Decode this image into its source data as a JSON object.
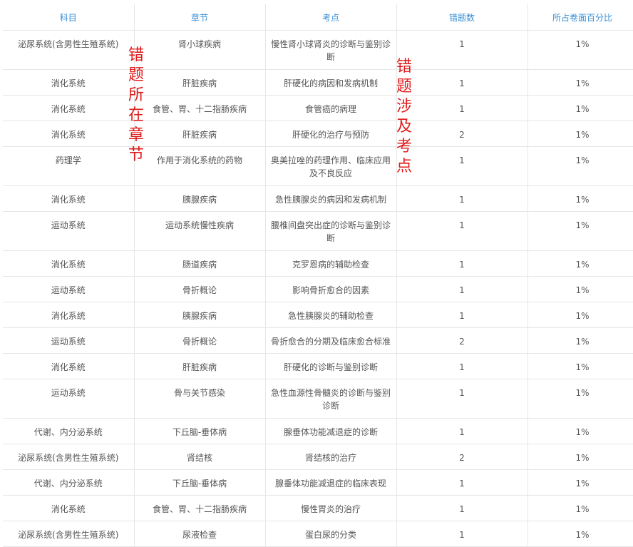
{
  "table": {
    "headers": [
      "科目",
      "章节",
      "考点",
      "错题数",
      "所占卷面百分比"
    ],
    "rows": [
      {
        "subject": "泌尿系统(含男性生殖系统)",
        "chapter": "肾小球疾病",
        "point": "慢性肾小球肾炎的诊断与鉴别诊断",
        "count": "1",
        "percent": "1%"
      },
      {
        "subject": "消化系统",
        "chapter": "肝脏疾病",
        "point": "肝硬化的病因和发病机制",
        "count": "1",
        "percent": "1%"
      },
      {
        "subject": "消化系统",
        "chapter": "食管、胃、十二指肠疾病",
        "point": "食管癌的病理",
        "count": "1",
        "percent": "1%"
      },
      {
        "subject": "消化系统",
        "chapter": "肝脏疾病",
        "point": "肝硬化的治疗与预防",
        "count": "2",
        "percent": "1%"
      },
      {
        "subject": "药理学",
        "chapter": "作用于消化系统的药物",
        "point": "奥美拉唑的药理作用、临床应用及不良反应",
        "count": "1",
        "percent": "1%"
      },
      {
        "subject": "消化系统",
        "chapter": "胰腺疾病",
        "point": "急性胰腺炎的病因和发病机制",
        "count": "1",
        "percent": "1%"
      },
      {
        "subject": "运动系统",
        "chapter": "运动系统慢性疾病",
        "point": "腰椎间盘突出症的诊断与鉴别诊断",
        "count": "1",
        "percent": "1%"
      },
      {
        "subject": "消化系统",
        "chapter": "肠道疾病",
        "point": "克罗恩病的辅助检查",
        "count": "1",
        "percent": "1%"
      },
      {
        "subject": "运动系统",
        "chapter": "骨折概论",
        "point": "影响骨折愈合的因素",
        "count": "1",
        "percent": "1%"
      },
      {
        "subject": "消化系统",
        "chapter": "胰腺疾病",
        "point": "急性胰腺炎的辅助检查",
        "count": "1",
        "percent": "1%"
      },
      {
        "subject": "运动系统",
        "chapter": "骨折概论",
        "point": "骨折愈合的分期及临床愈合标准",
        "count": "2",
        "percent": "1%"
      },
      {
        "subject": "消化系统",
        "chapter": "肝脏疾病",
        "point": "肝硬化的诊断与鉴别诊断",
        "count": "1",
        "percent": "1%"
      },
      {
        "subject": "运动系统",
        "chapter": "骨与关节感染",
        "point": "急性血源性骨髓炎的诊断与鉴别诊断",
        "count": "1",
        "percent": "1%"
      },
      {
        "subject": "代谢、内分泌系统",
        "chapter": "下丘脑-垂体病",
        "point": "腺垂体功能减退症的诊断",
        "count": "1",
        "percent": "1%"
      },
      {
        "subject": "泌尿系统(含男性生殖系统)",
        "chapter": "肾结核",
        "point": "肾结核的治疗",
        "count": "2",
        "percent": "1%"
      },
      {
        "subject": "代谢、内分泌系统",
        "chapter": "下丘脑-垂体病",
        "point": "腺垂体功能减退症的临床表现",
        "count": "1",
        "percent": "1%"
      },
      {
        "subject": "消化系统",
        "chapter": "食管、胃、十二指肠疾病",
        "point": "慢性胃炎的治疗",
        "count": "1",
        "percent": "1%"
      },
      {
        "subject": "泌尿系统(含男性生殖系统)",
        "chapter": "尿液检查",
        "point": "蛋白尿的分类",
        "count": "1",
        "percent": "1%"
      }
    ]
  },
  "annotations": {
    "chapter_note": "错题所在章节",
    "point_note": "错题涉及考点"
  }
}
